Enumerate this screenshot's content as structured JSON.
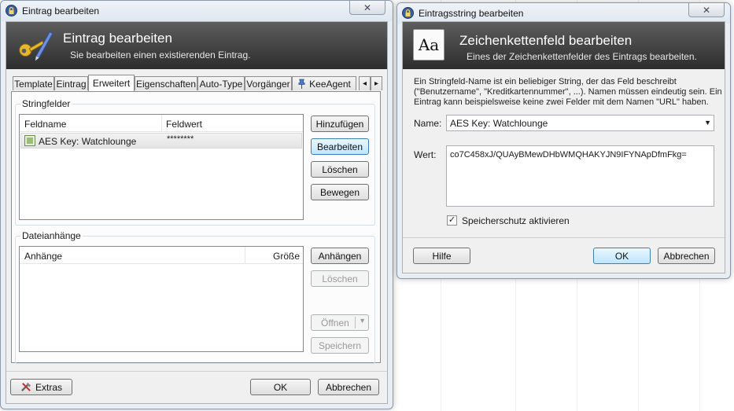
{
  "left_window": {
    "title": "Eintrag bearbeiten",
    "close_symbol": "✕",
    "banner_title": "Eintrag bearbeiten",
    "banner_subtitle": "Sie bearbeiten einen existierenden Eintrag.",
    "banner_icon": "key-pen-icon",
    "tabs": [
      {
        "label": "Template"
      },
      {
        "label": "Eintrag"
      },
      {
        "label": "Erweitert",
        "active": true
      },
      {
        "label": "Eigenschaften"
      },
      {
        "label": "Auto-Type"
      },
      {
        "label": "Vorgänger"
      },
      {
        "label": "KeeAgent"
      }
    ],
    "tab_scroll_left": "◂",
    "tab_scroll_right": "▸",
    "stringfields": {
      "group_label": "Stringfelder",
      "columns": [
        "Feldname",
        "Feldwert"
      ],
      "rows": [
        {
          "name": "AES Key: Watchlounge",
          "value": "********"
        }
      ],
      "buttons": {
        "add": "Hinzufügen",
        "edit": "Bearbeiten",
        "delete": "Löschen",
        "move": "Bewegen"
      }
    },
    "attachments": {
      "group_label": "Dateianhänge",
      "columns": [
        "Anhänge",
        "Größe"
      ],
      "buttons": {
        "attach": "Anhängen",
        "delete": "Löschen",
        "open": "Öffnen",
        "save": "Speichern"
      }
    },
    "footer": {
      "extras": "Extras",
      "ok": "OK",
      "cancel": "Abbrechen"
    }
  },
  "right_window": {
    "title": "Eintragsstring bearbeiten",
    "close_symbol": "✕",
    "banner_icon_text": "Aa",
    "banner_title": "Zeichenkettenfeld bearbeiten",
    "banner_subtitle": "Eines der Zeichenkettenfelder des Eintrags bearbeiten.",
    "description": "Ein Stringfeld-Name ist ein beliebiger String, der das Feld beschreibt (\"Benutzername\", \"Kreditkartennummer\", ...). Namen müssen eindeutig sein. Ein Eintrag kann beispielsweise keine zwei Felder mit dem Namen \"URL\" haben.",
    "name_label": "Name:",
    "name_value": "AES Key: Watchlounge",
    "value_label": "Wert:",
    "value_value": "co7C458xJ/QUAyBMewDHbWMQHAKYJN9IFYNApDfmFkg=",
    "protect_label": "Speicherschutz aktivieren",
    "protect_checked": "✓",
    "buttons": {
      "help": "Hilfe",
      "ok": "OK",
      "cancel": "Abbrechen"
    }
  },
  "colors": {
    "banner_dark": "#2d2d2d",
    "focus_blue": "#3c7fb1",
    "window_bg": "#e9eef4"
  }
}
